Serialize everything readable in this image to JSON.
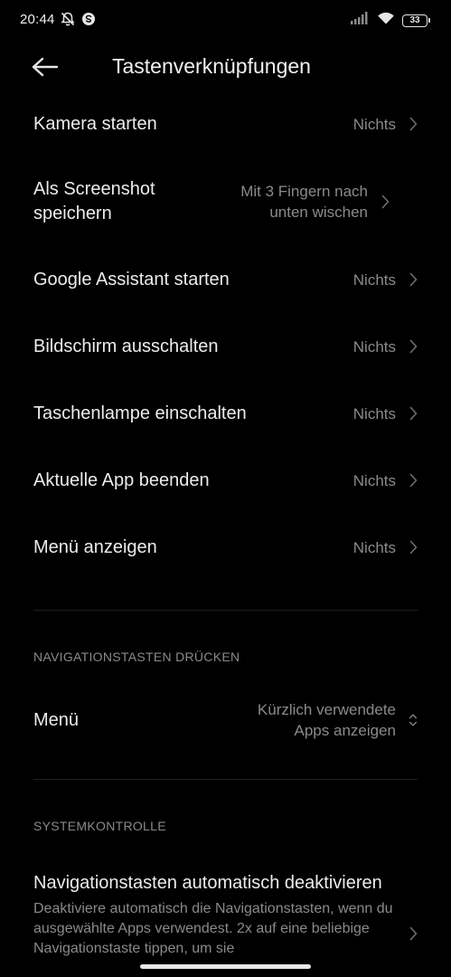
{
  "status_bar": {
    "time": "20:44",
    "battery": "33"
  },
  "header": {
    "title": "Tastenverknüpfungen"
  },
  "shortcuts": [
    {
      "title": "Kamera starten",
      "value": "Nichts"
    },
    {
      "title": "Als Screenshot speichern",
      "value": "Mit 3 Fingern nach unten wischen"
    },
    {
      "title": "Google Assistant starten",
      "value": "Nichts"
    },
    {
      "title": "Bildschirm ausschalten",
      "value": "Nichts"
    },
    {
      "title": "Taschenlampe einschalten",
      "value": "Nichts"
    },
    {
      "title": "Aktuelle App beenden",
      "value": "Nichts"
    },
    {
      "title": "Menü anzeigen",
      "value": "Nichts"
    }
  ],
  "nav_section": {
    "header": "NAVIGATIONSTASTEN DRÜCKEN",
    "item": {
      "title": "Menü",
      "value": "Kürzlich verwendete Apps anzeigen"
    }
  },
  "system_section": {
    "header": "SYSTEMKONTROLLE",
    "item": {
      "title": "Navigationstasten automatisch deaktivieren",
      "description": "Deaktiviere automatisch die Navigationstasten, wenn du ausgewählte Apps verwendest. 2x auf eine beliebige Navigationstaste tippen, um sie"
    }
  },
  "colors": {
    "background": "#000000",
    "text_primary": "#ececec",
    "text_secondary": "#8a8a8a"
  }
}
